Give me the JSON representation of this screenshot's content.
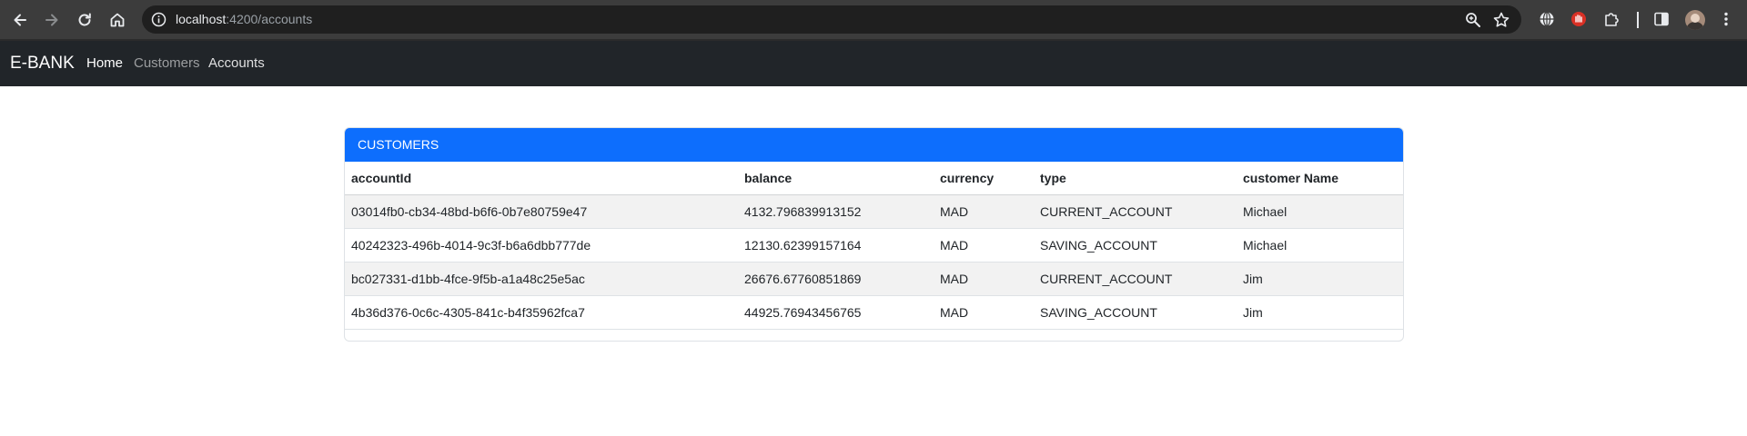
{
  "browser": {
    "url_host": "localhost",
    "url_path": ":4200/accounts"
  },
  "navbar": {
    "brand": "E-BANK",
    "links": [
      {
        "label": "Home"
      },
      {
        "label": "Customers"
      },
      {
        "label": "Accounts"
      }
    ]
  },
  "card": {
    "header": "CUSTOMERS",
    "columns": [
      "accountId",
      "balance",
      "currency",
      "type",
      "customer Name"
    ],
    "rows": [
      [
        "03014fb0-cb34-48bd-b6f6-0b7e80759e47",
        "4132.796839913152",
        "MAD",
        "CURRENT_ACCOUNT",
        "Michael"
      ],
      [
        "40242323-496b-4014-9c3f-b6a6dbb777de",
        "12130.62399157164",
        "MAD",
        "SAVING_ACCOUNT",
        "Michael"
      ],
      [
        "bc027331-d1bb-4fce-9f5b-a1a48c25e5ac",
        "26676.67760851869",
        "MAD",
        "CURRENT_ACCOUNT",
        "Jim"
      ],
      [
        "4b36d376-0c6c-4305-841c-b4f35962fca7",
        "44925.76943456765",
        "MAD",
        "SAVING_ACCOUNT",
        "Jim"
      ]
    ]
  },
  "colors": {
    "header_blue": "#0d6efd",
    "navbar_dark": "#212529",
    "chrome_dark": "#3c3c3c"
  }
}
